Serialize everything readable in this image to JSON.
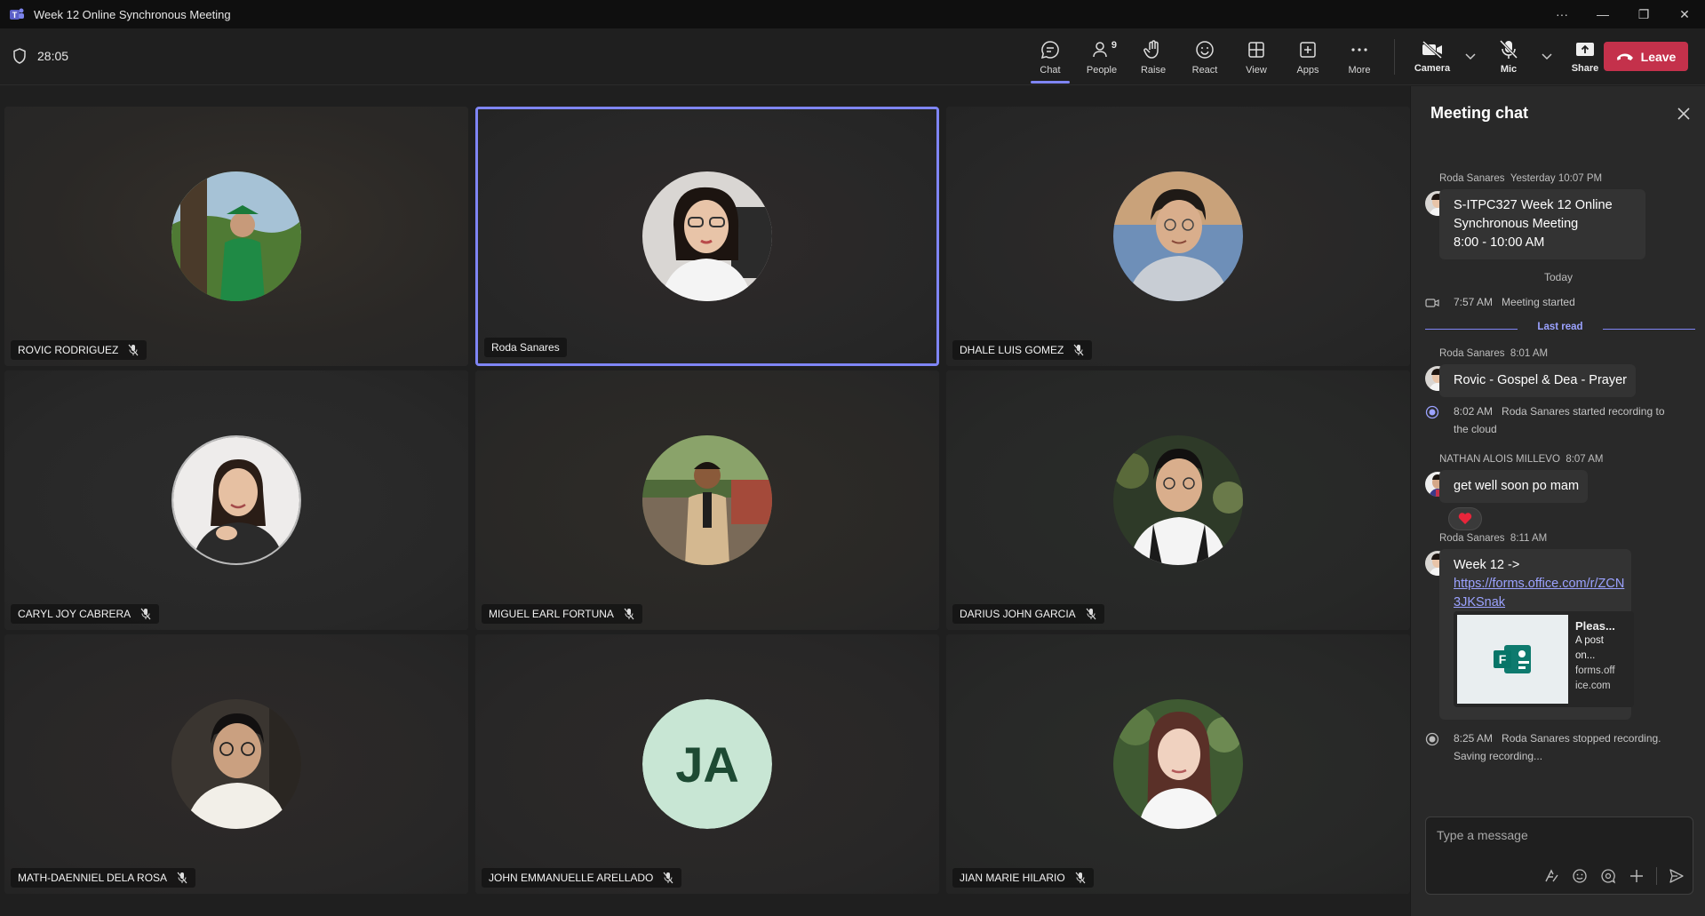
{
  "window": {
    "title": "Week 12 Online Synchronous Meeting",
    "controls": {
      "more": "···",
      "minimize": "—",
      "restore": "❐",
      "close": "✕"
    }
  },
  "toolbar": {
    "timer": "28:05",
    "items": [
      {
        "id": "chat",
        "label": "Chat",
        "icon": "chat-icon",
        "active": true
      },
      {
        "id": "people",
        "label": "People",
        "icon": "people-icon",
        "count": "9"
      },
      {
        "id": "raise",
        "label": "Raise",
        "icon": "hand-icon"
      },
      {
        "id": "react",
        "label": "React",
        "icon": "smiley-icon"
      },
      {
        "id": "view",
        "label": "View",
        "icon": "grid-icon"
      },
      {
        "id": "apps",
        "label": "Apps",
        "icon": "plus-square-icon"
      },
      {
        "id": "more",
        "label": "More",
        "icon": "ellipsis-icon"
      }
    ],
    "camera_label": "Camera",
    "mic_label": "Mic",
    "share_label": "Share",
    "leave_label": "Leave",
    "leave_color": "#c4314b",
    "accent": "#7f85f5"
  },
  "participants": [
    {
      "name": "ROVIC RODRIGUEZ",
      "muted": true,
      "selected": false
    },
    {
      "name": "Roda Sanares",
      "muted": false,
      "selected": true
    },
    {
      "name": "DHALE LUIS GOMEZ",
      "muted": true,
      "selected": false
    },
    {
      "name": "CARYL JOY CABRERA",
      "muted": true,
      "selected": false
    },
    {
      "name": "MIGUEL EARL FORTUNA",
      "muted": true,
      "selected": false
    },
    {
      "name": "DARIUS JOHN GARCIA",
      "muted": true,
      "selected": false
    },
    {
      "name": "MATH-DAENNIEL DELA ROSA",
      "muted": true,
      "selected": false
    },
    {
      "name": "JOHN EMMANUELLE ARELLADO",
      "muted": true,
      "selected": false,
      "initials": "JA"
    },
    {
      "name": "JIAN MARIE HILARIO",
      "muted": true,
      "selected": false
    }
  ],
  "chat": {
    "title": "Meeting chat",
    "messages": {
      "m1": {
        "sender": "Roda Sanares",
        "time": "Yesterday 10:07 PM",
        "lines": [
          "S-ITPC327 Week 12 Online",
          "Synchronous Meeting",
          "8:00 - 10:00 AM"
        ]
      },
      "today_label": "Today",
      "sys1": {
        "time": "7:57 AM",
        "text": "Meeting started"
      },
      "last_read": "Last read",
      "m2": {
        "sender": "Roda Sanares",
        "time": "8:01 AM",
        "text": "Rovic - Gospel & Dea - Prayer"
      },
      "sys2": {
        "time": "8:02 AM",
        "text_line1": "Roda Sanares started recording to",
        "text_line2": "the cloud"
      },
      "m3": {
        "sender": "NATHAN ALOIS MILLEVO",
        "time": "8:07 AM",
        "text": "get well soon po mam",
        "reaction": "heart"
      },
      "m4": {
        "sender": "Roda Sanares",
        "time": "8:11 AM",
        "text": "Week 12 ->",
        "link_line1": "https://forms.office.com/r/ZCN",
        "link_line2": "3JKSnak",
        "card": {
          "title": "Pleas...",
          "desc1": "A post",
          "desc2": "on...",
          "domain1": "forms.off",
          "domain2": "ice.com"
        }
      },
      "sys3": {
        "time": "8:25 AM",
        "text_line1": "Roda Sanares stopped recording.",
        "text_line2": "Saving recording..."
      }
    },
    "composer_placeholder": "Type a message"
  }
}
